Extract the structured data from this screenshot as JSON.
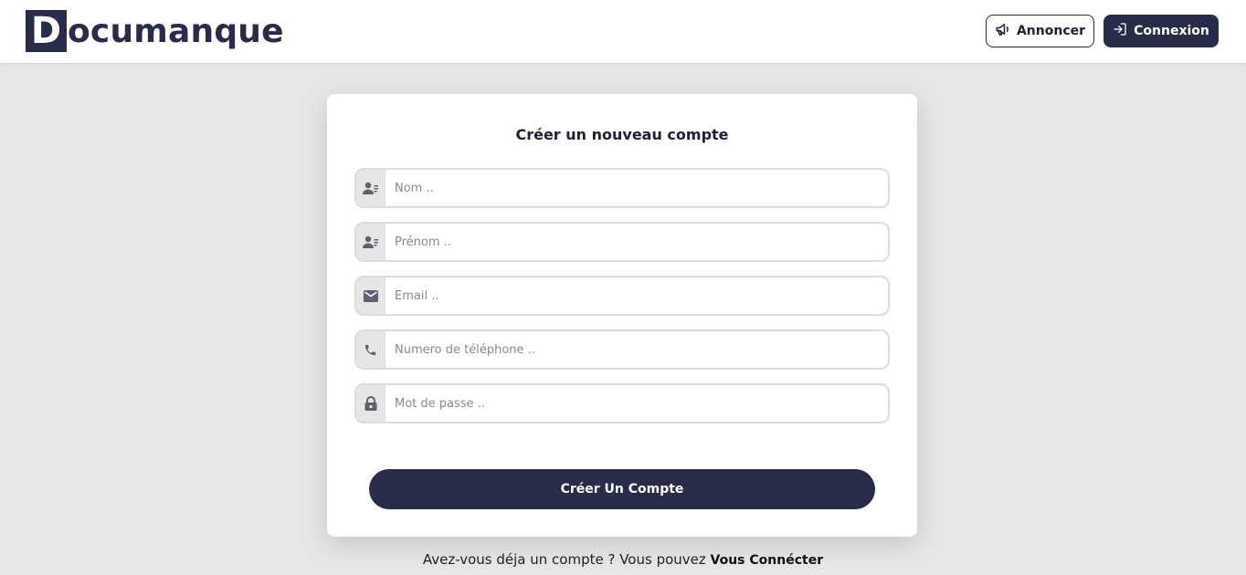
{
  "header": {
    "logo_letter": "D",
    "logo_rest": "ocumanque",
    "announce_label": "Annoncer",
    "login_label": "Connexion"
  },
  "form": {
    "title": "Créer un nouveau compte",
    "fields": [
      {
        "icon": "contact-card-icon",
        "placeholder": "Nom .."
      },
      {
        "icon": "contact-card-icon",
        "placeholder": "Prénom .."
      },
      {
        "icon": "envelope-icon",
        "placeholder": "Email .."
      },
      {
        "icon": "phone-icon",
        "placeholder": "Numero de téléphone .."
      },
      {
        "icon": "lock-icon",
        "placeholder": "Mot de passe .."
      }
    ],
    "submit_label": "Créer Un Compte"
  },
  "footer": {
    "prompt": "Avez-vous déja un compte ? Vous pouvez ",
    "link_label": "Vous Connécter"
  },
  "colors": {
    "brand": "#282c49",
    "background": "#e7e7e7",
    "card": "#ffffff"
  }
}
